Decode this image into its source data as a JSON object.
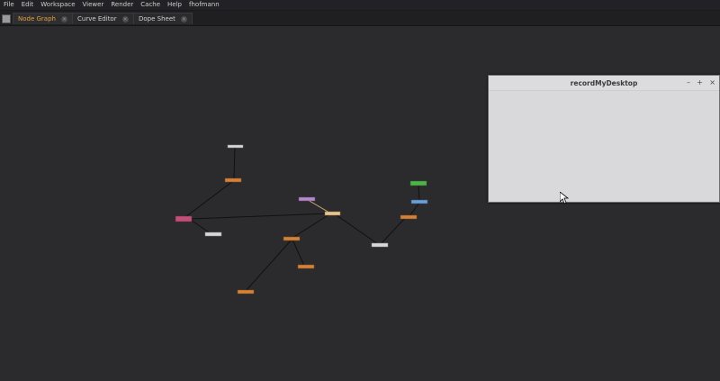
{
  "menubar": {
    "items": [
      "File",
      "Edit",
      "Workspace",
      "Viewer",
      "Render",
      "Cache",
      "Help",
      "fhofmann"
    ]
  },
  "tabs": [
    {
      "label": "Node Graph",
      "active": true
    },
    {
      "label": "Curve Editor",
      "active": false
    },
    {
      "label": "Dope Sheet",
      "active": false
    }
  ],
  "record_window": {
    "title": "recordMyDesktop",
    "minimize": "–",
    "maximize": "+",
    "close": "×"
  },
  "colors": {
    "accent": "#e6a13a",
    "background": "#2b2a2d",
    "node_orange": "#d4813a",
    "node_white": "#d8d8d8",
    "node_pink": "#c0507a",
    "node_purple": "#b48acb",
    "node_cream": "#e8c48e",
    "node_green": "#4fb24a",
    "node_blue": "#6a9fd4"
  }
}
